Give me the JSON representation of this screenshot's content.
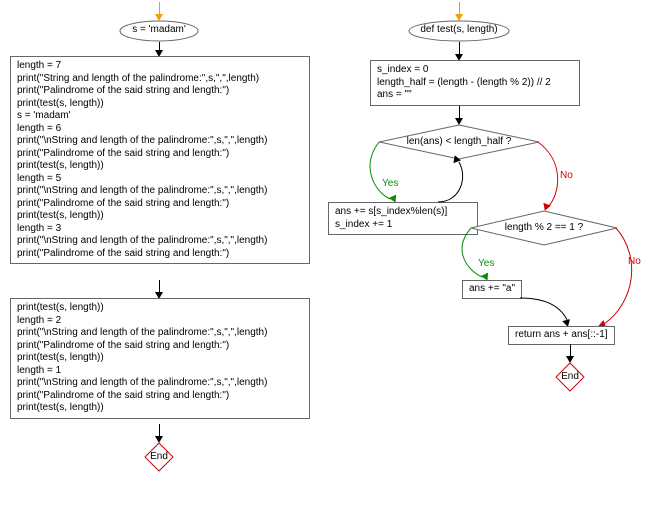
{
  "left": {
    "start_label": "s = 'madam'",
    "block1_lines": [
      "length = 7",
      "print(\"String and length of the palindrome:\",s,\",\",length)",
      "print(\"Palindrome of the said string and length:\")",
      "print(test(s, length))",
      "s = 'madam'",
      "length = 6",
      "print(\"\\nString and length of the palindrome:\",s,\",\",length)",
      "print(\"Palindrome of the said string and length:\")",
      "print(test(s, length))",
      "length = 5",
      "print(\"\\nString and length of the palindrome:\",s,\",\",length)",
      "print(\"Palindrome of the said string and length:\")",
      "print(test(s, length))",
      "length = 3",
      "print(\"\\nString and length of the palindrome:\",s,\",\",length)",
      "print(\"Palindrome of the said string and length:\")"
    ],
    "block2_lines": [
      "print(test(s, length))",
      "length = 2",
      "print(\"\\nString and length of the palindrome:\",s,\",\",length)",
      "print(\"Palindrome of the said string and length:\")",
      "print(test(s, length))",
      "length = 1",
      "print(\"\\nString and length of the palindrome:\",s,\",\",length)",
      "print(\"Palindrome of the said string and length:\")",
      "print(test(s, length))"
    ],
    "end_label": "End"
  },
  "right": {
    "start_label": "def test(s, length)",
    "init_lines": [
      "s_index = 0",
      "length_half = (length - (length % 2)) // 2",
      "ans = \"\""
    ],
    "cond1": "len(ans) < length_half ?",
    "cond1_yes_label": "Yes",
    "cond1_no_label": "No",
    "loop_body_lines": [
      "ans += s[s_index%len(s)]",
      "s_index += 1"
    ],
    "cond2": "length % 2 == 1 ?",
    "cond2_yes_label": "Yes",
    "cond2_no_label": "No",
    "append_a": "ans += \"a\"",
    "return_line": "return ans + ans[::-1]",
    "end_label": "End"
  }
}
